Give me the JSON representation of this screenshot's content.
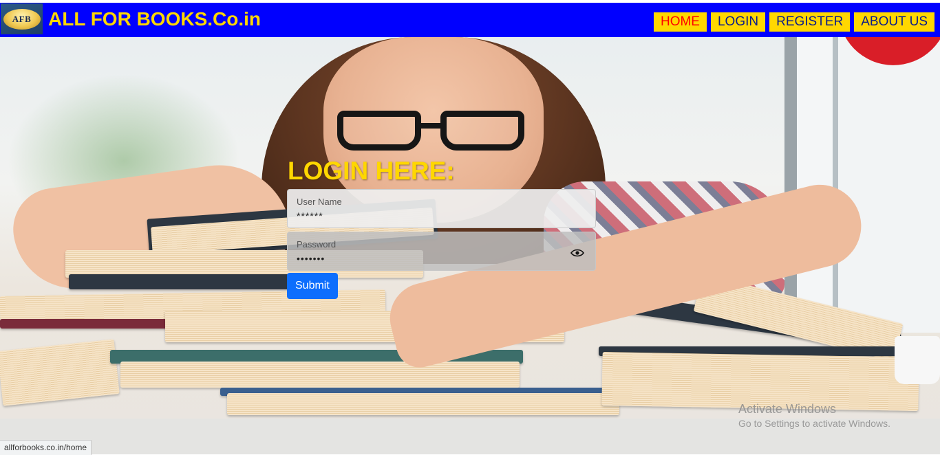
{
  "navbar": {
    "logo_text": "AFB",
    "brand": "ALL FOR BOOKS.Co.in",
    "links": [
      {
        "label": "HOME",
        "active": true
      },
      {
        "label": "LOGIN",
        "active": false
      },
      {
        "label": "REGISTER",
        "active": false
      },
      {
        "label": "ABOUT US",
        "active": false
      }
    ]
  },
  "login": {
    "title": "LOGIN HERE:",
    "username": {
      "label": "User Name",
      "value": "******"
    },
    "password": {
      "label": "Password",
      "value": "•••••••",
      "toggle_icon": "eye-icon"
    },
    "submit_label": "Submit"
  },
  "watermark": {
    "title": "Activate Windows",
    "subtitle": "Go to Settings to activate Windows."
  },
  "status_bar": {
    "url": "allforbooks.co.in/home"
  },
  "colors": {
    "navbar_bg": "#0000ff",
    "brand_text": "#ffd700",
    "nav_button_bg": "#ffd700",
    "active_link": "#ff0000",
    "submit_bg": "#0d6efd"
  }
}
